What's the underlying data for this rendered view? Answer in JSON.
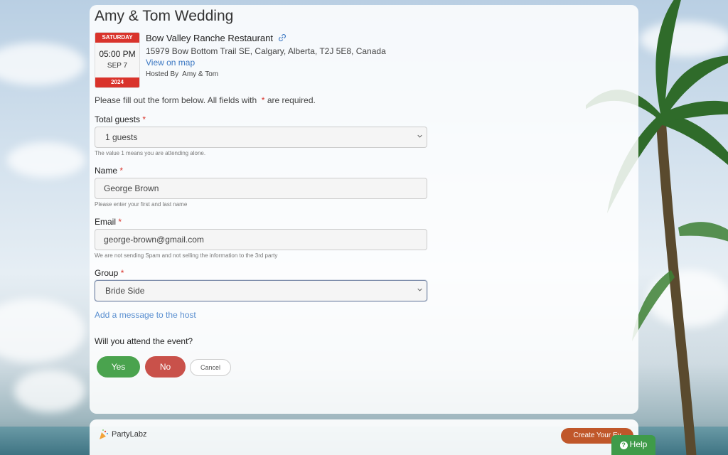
{
  "event": {
    "title": "Amy & Tom Wedding",
    "weekday": "SATURDAY",
    "time": "05:00 PM",
    "month_day": "SEP 7",
    "year": "2024",
    "venue": "Bow Valley Ranche Restaurant",
    "address": "15979 Bow Bottom Trail SE, Calgary, Alberta, T2J 5E8, Canada",
    "map_link": "View on map",
    "hosted_by_label": "Hosted By",
    "hosts": "Amy & Tom"
  },
  "form": {
    "instructions_pre": "Please fill out the form below. All fields with",
    "required_mark": "*",
    "instructions_post": "are required.",
    "guests": {
      "label": "Total guests",
      "value": "1 guests",
      "hint": "The value 1 means you are attending alone."
    },
    "name": {
      "label": "Name",
      "value": "George Brown",
      "hint": "Please enter your first and last name"
    },
    "email": {
      "label": "Email",
      "value": "george-brown@gmail.com",
      "hint": "We are not sending Spam and not selling the information to the 3rd party"
    },
    "group": {
      "label": "Group",
      "value": "Bride Side"
    },
    "add_message": "Add a message to the host",
    "question": "Will you attend the event?",
    "yes": "Yes",
    "no": "No",
    "cancel": "Cancel"
  },
  "footer": {
    "logo_text": "PartyLabz",
    "create_button": "Create Your Ev",
    "help_button": "Help"
  },
  "colors": {
    "accent_red": "#d9332b",
    "yes_green": "#4aa34e",
    "no_red": "#c9514a",
    "link_blue": "#3a77c2",
    "create_orange": "#c0572a",
    "help_green": "#3f9b49"
  }
}
